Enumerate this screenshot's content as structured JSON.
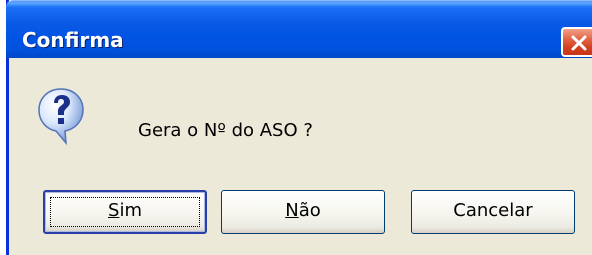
{
  "window": {
    "title": "Confirma"
  },
  "dialog": {
    "icon": "question-icon",
    "message": "Gera o Nº do ASO ?"
  },
  "buttons": {
    "yes": {
      "mnemonic": "S",
      "rest": "im"
    },
    "no": {
      "mnemonic": "N",
      "rest": "ão"
    },
    "cancel": {
      "label": "Cancelar"
    }
  },
  "colors": {
    "titlebar": "#0054e3",
    "close_button": "#d5401f",
    "dialog_background": "#ece9d8",
    "button_border": "#003c74"
  }
}
